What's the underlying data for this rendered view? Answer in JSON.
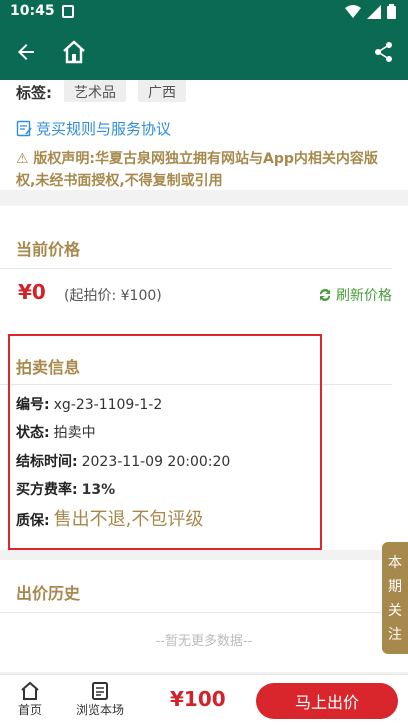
{
  "status_bar": {
    "time": "10:45"
  },
  "app_bar": {},
  "tags": {
    "label": "标签:",
    "items": [
      "艺术品",
      "广西"
    ]
  },
  "rules_link": "竞买规则与服务协议",
  "copyright": "⚠ 版权声明:华夏古泉网独立拥有网站与App内相关内容版权,未经书面授权,不得复制或引用",
  "price_section": {
    "title": "当前价格",
    "current": "¥0",
    "start_price": "(起拍价: ¥100)",
    "refresh": "刷新价格"
  },
  "auction_info": {
    "title": "拍卖信息",
    "rows": [
      {
        "k": "编号:",
        "v": "xg-23-1109-1-2"
      },
      {
        "k": "状态:",
        "v": "拍卖中"
      },
      {
        "k": "结标时间:",
        "v": "2023-11-09 20:00:20"
      },
      {
        "k": "买方费率:",
        "v": "13%"
      },
      {
        "k": "质保:",
        "v": "售出不退,不包评级"
      }
    ]
  },
  "bid_history": {
    "title": "出价历史",
    "empty": "--暂无更多数据--"
  },
  "follow_tab": [
    "本",
    "期",
    "关",
    "注"
  ],
  "bottom_bar": {
    "home": "首页",
    "browse": "浏览本场",
    "amount": "¥100",
    "bid_button": "马上出价"
  },
  "colors": {
    "primary": "#0b6b52",
    "accent": "#a8894d",
    "red": "#d3232a"
  }
}
